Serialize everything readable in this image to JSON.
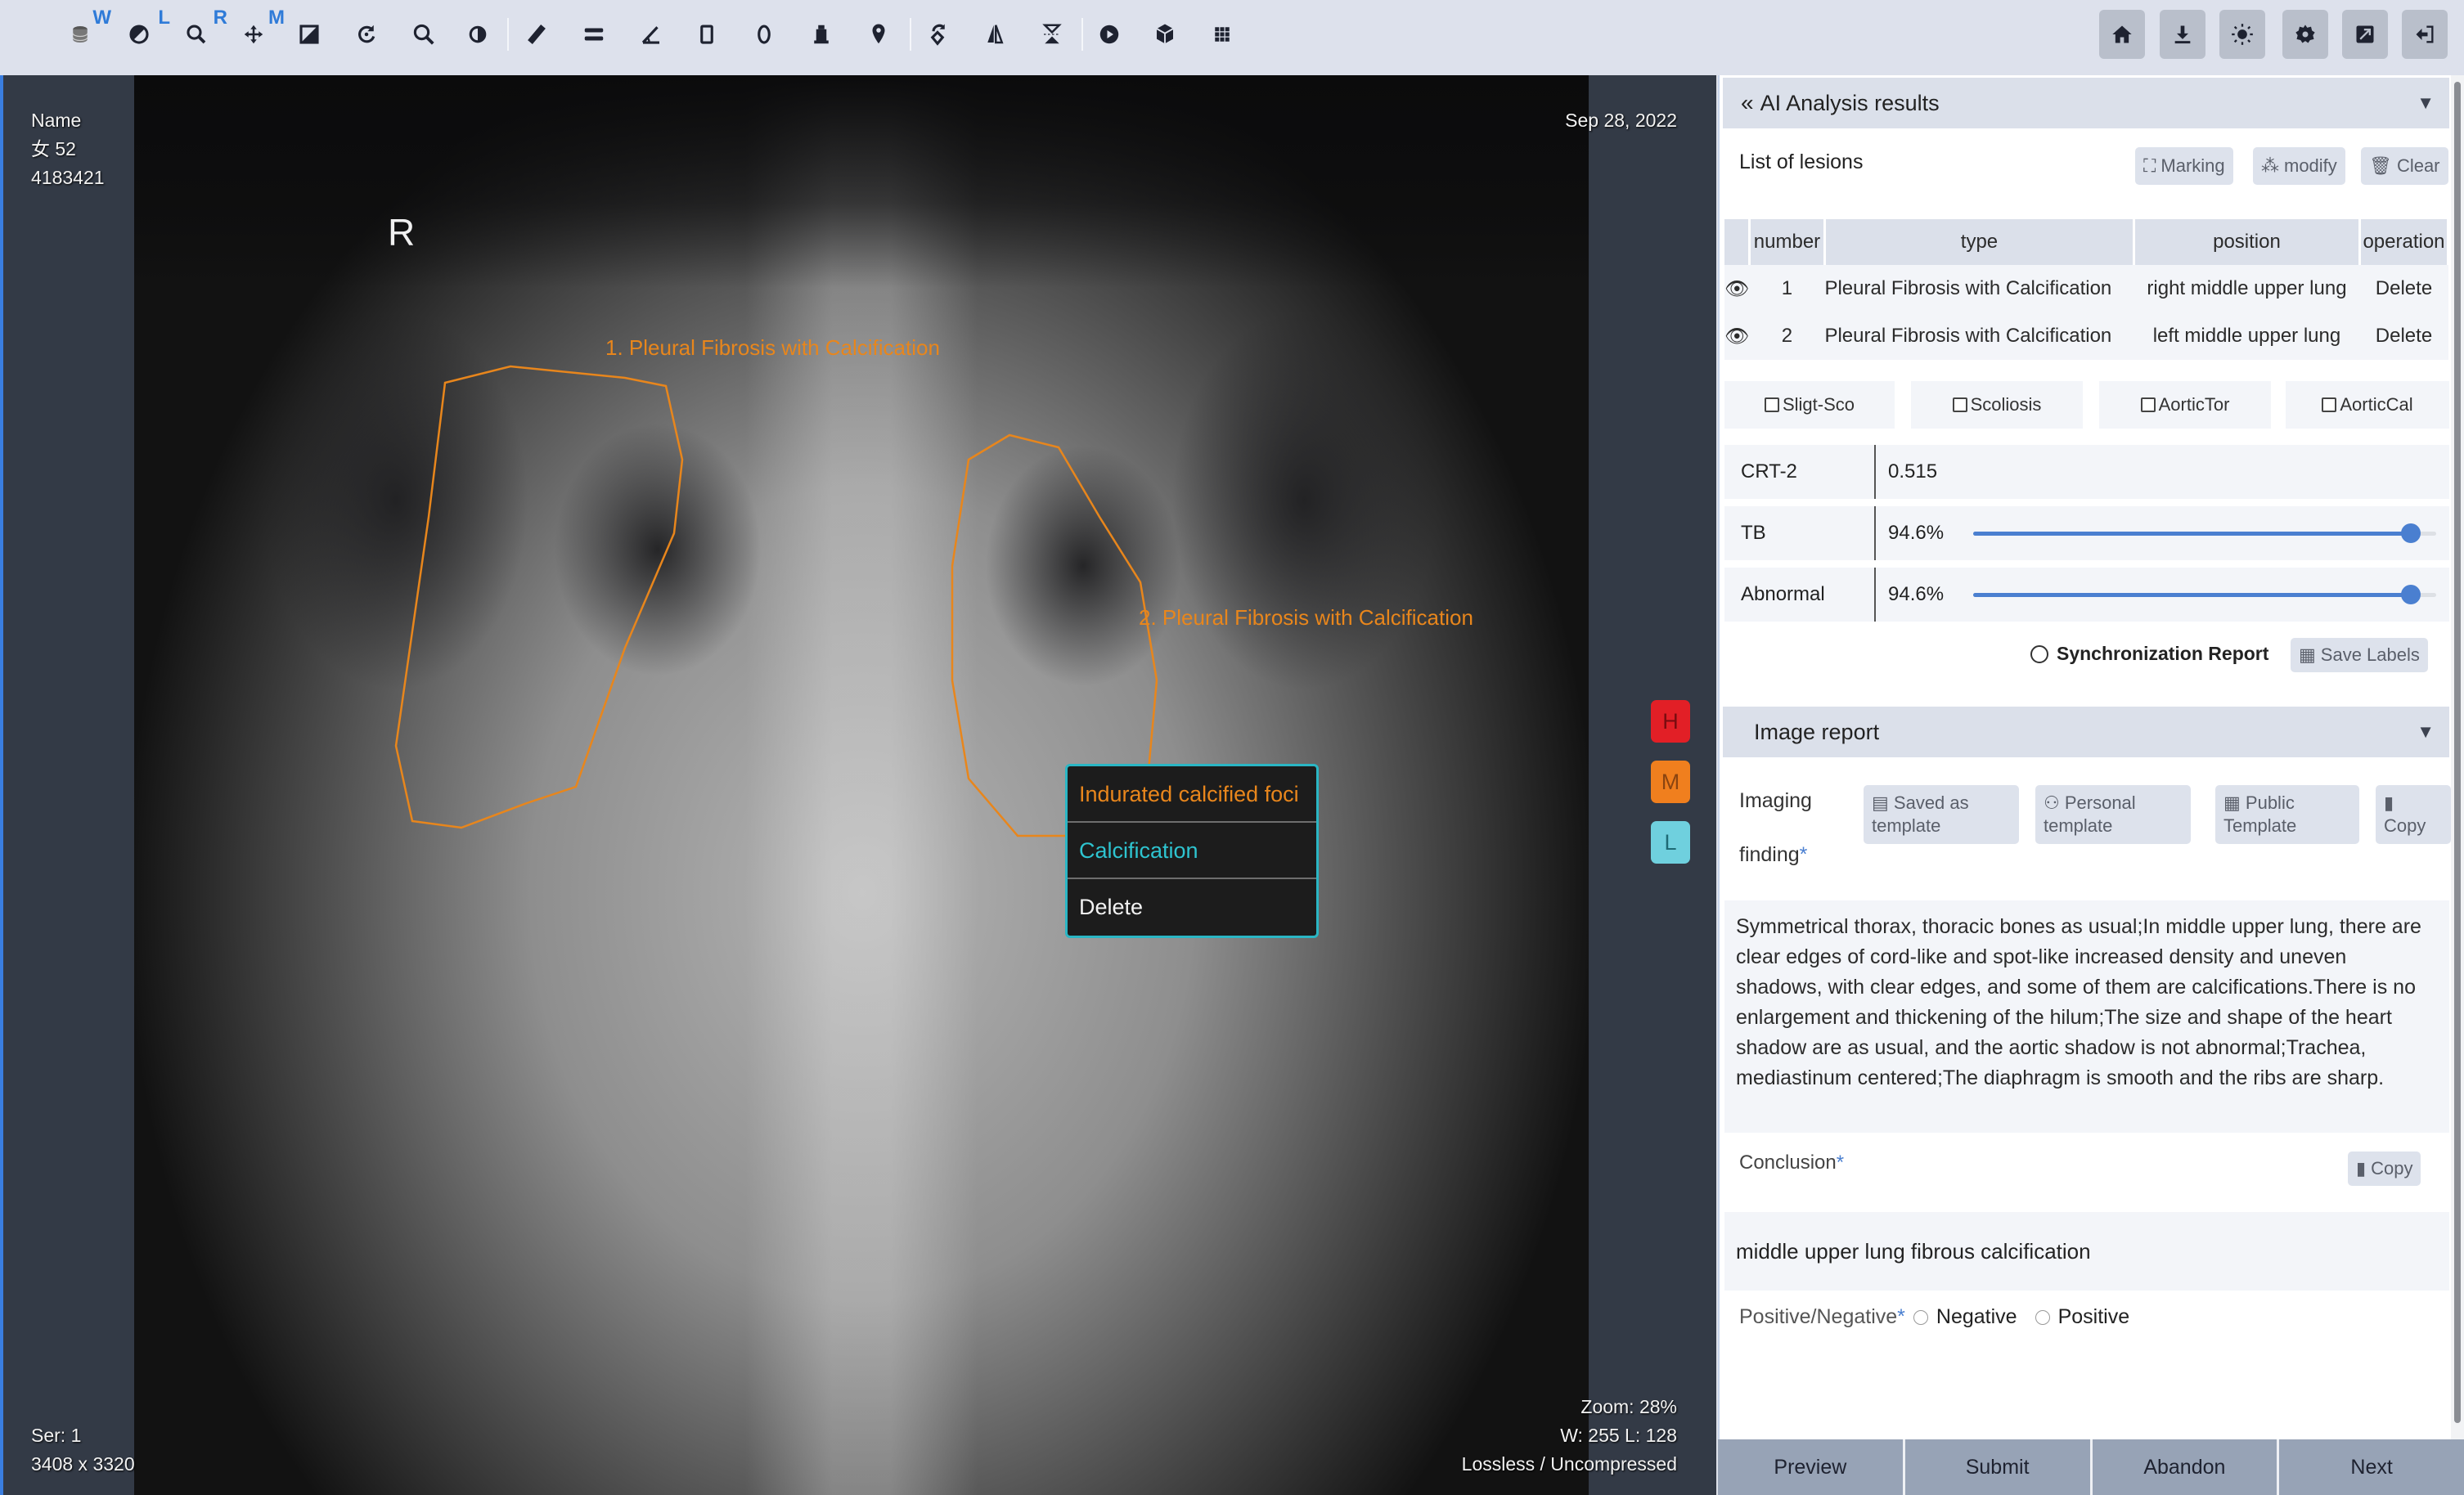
{
  "toolbar": {
    "tools": [
      {
        "name": "stack-icon",
        "sup": "W"
      },
      {
        "name": "window-level-icon",
        "sup": "L"
      },
      {
        "name": "zoom-icon",
        "sup": "R"
      },
      {
        "name": "pan-icon",
        "sup": "M"
      },
      {
        "name": "crop-icon"
      },
      {
        "name": "rotate-icon"
      },
      {
        "name": "magnifier-icon"
      },
      {
        "name": "invert-icon"
      },
      {
        "name": "ruler-icon"
      },
      {
        "name": "bidirectional-icon"
      },
      {
        "name": "angle-icon"
      },
      {
        "name": "rectangle-roi-icon"
      },
      {
        "name": "ellipse-roi-icon"
      },
      {
        "name": "probe-icon"
      },
      {
        "name": "pin-icon"
      },
      {
        "name": "flip-rotate-icon"
      },
      {
        "name": "flip-horizontal-icon"
      },
      {
        "name": "flip-vertical-icon"
      },
      {
        "name": "cine-play-icon"
      },
      {
        "name": "3d-cube-icon"
      },
      {
        "name": "layout-grid-icon"
      }
    ],
    "right_buttons": [
      {
        "name": "home-icon"
      },
      {
        "name": "download-icon"
      },
      {
        "name": "brightness-icon"
      },
      {
        "name": "settings-icon"
      },
      {
        "name": "fullscreen-icon"
      },
      {
        "name": "logout-icon"
      }
    ]
  },
  "viewer": {
    "patient_name": "Name",
    "patient_sex_age": "女  52",
    "patient_id": "4183421",
    "study_date": "Sep 28, 2022",
    "orientation": "R",
    "series": "Ser: 1",
    "dimensions": "3408 x 3320",
    "zoom": "Zoom: 28%",
    "window_level": "W: 255 L: 128",
    "compression": "Lossless / Uncompressed",
    "lesion_labels": [
      "1. Pleural Fibrosis with Calcification",
      "2. Pleural Fibrosis with Calcification"
    ],
    "context_menu": {
      "items": [
        {
          "label": "Indurated calcified foci",
          "color": "#e8861c"
        },
        {
          "label": "Calcification",
          "color": "#2ec4d0"
        },
        {
          "label": "Delete",
          "color": "#f2f2f2"
        }
      ]
    },
    "severity": [
      {
        "label": "H",
        "color": "#e21f26"
      },
      {
        "label": "M",
        "color": "#f07f1e"
      },
      {
        "label": "L",
        "color": "#6fd0de"
      }
    ]
  },
  "ai_panel": {
    "title": "AI Analysis results",
    "lesions_title": "List of lesions",
    "buttons": {
      "marking": "Marking",
      "modify": "modify",
      "clear": "Clear"
    },
    "table": {
      "headers": [
        "number",
        "type",
        "position",
        "operation"
      ],
      "rows": [
        {
          "number": "1",
          "type": "Pleural Fibrosis with Calcification",
          "position": "right middle upper lung",
          "operation": "Delete"
        },
        {
          "number": "2",
          "type": "Pleural Fibrosis with Calcification",
          "position": "left middle upper lung",
          "operation": "Delete"
        }
      ]
    },
    "checkboxes": [
      {
        "label": "Sligt-Sco",
        "checked": false
      },
      {
        "label": "Scoliosis",
        "checked": false
      },
      {
        "label": "AorticTor",
        "checked": false
      },
      {
        "label": "AorticCal",
        "checked": false
      }
    ],
    "metrics": {
      "crt": {
        "label": "CRT-2",
        "value": "0.515"
      },
      "tb": {
        "label": "TB",
        "value": "94.6%",
        "fraction": 0.946
      },
      "abnormal": {
        "label": "Abnormal",
        "value": "94.6%",
        "fraction": 0.946
      }
    },
    "sync_report": "Synchronization Report",
    "save_labels": "Save Labels"
  },
  "report": {
    "title": "Image report",
    "finding_label_1": "Imaging",
    "finding_label_2": "finding",
    "buttons": {
      "saved_template_1": "Saved as",
      "saved_template_2": "template",
      "personal_1": "Personal",
      "personal_2": "template",
      "public_1": "Public",
      "public_2": "Template",
      "copy": "Copy"
    },
    "finding_text": "Symmetrical thorax, thoracic bones as usual;In middle upper lung, there are clear edges of cord-like and spot-like increased density and uneven shadows, with clear edges, and some of them are calcifications.There is no enlargement and thickening of the hilum;The size and shape of the heart shadow are as usual, and the aortic shadow is not abnormal;Trachea, mediastinum centered;The diaphragm is smooth and the ribs are sharp.",
    "conclusion_label": "Conclusion",
    "conclusion_copy": "Copy",
    "conclusion_text": "middle upper lung fibrous calcification",
    "posneg_label": "Positive/Negative",
    "negative": "Negative",
    "positive": "Positive",
    "required_mark": "*"
  },
  "footer": {
    "preview": "Preview",
    "submit": "Submit",
    "abandon": "Abandon",
    "next": "Next"
  }
}
